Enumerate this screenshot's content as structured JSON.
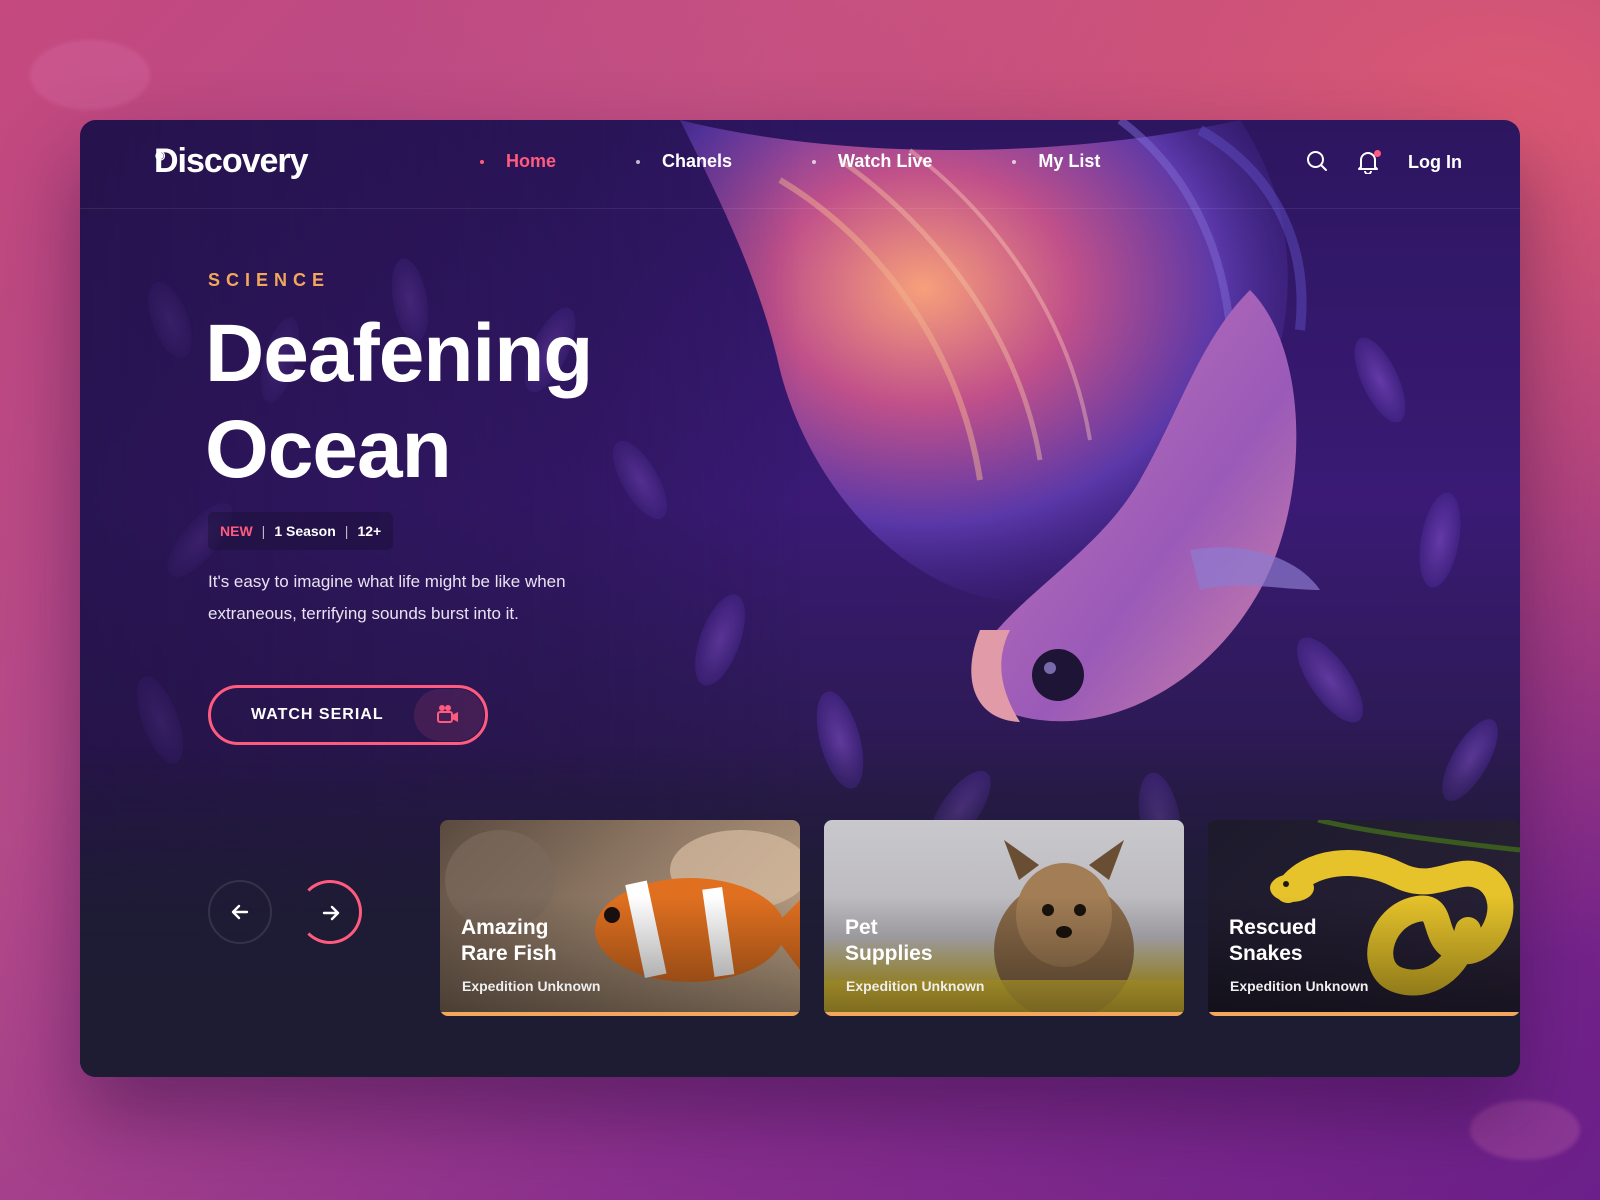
{
  "brand": {
    "name": "Discovery",
    "accent": "#ff5b7f",
    "secondary": "#f2a75c"
  },
  "nav": {
    "items": [
      {
        "label": "Home",
        "active": true
      },
      {
        "label": "Chanels",
        "active": false
      },
      {
        "label": "Watch Live",
        "active": false
      },
      {
        "label": "My List",
        "active": false
      }
    ],
    "search_icon": "search-icon",
    "bell_icon": "bell-icon",
    "login_label": "Log In"
  },
  "hero": {
    "category": "SCIENCE",
    "title_line1": "Deafening",
    "title_line2": "Ocean",
    "meta": {
      "badge": "NEW",
      "seasons": "1 Season",
      "rating": "12+"
    },
    "description": "It's easy to imagine what life might be like when extraneous, terrifying sounds burst into it.",
    "cta_label": "WATCH SERIAL",
    "cta_icon": "video-camera-icon"
  },
  "carousel": {
    "prev_icon": "arrow-left-icon",
    "next_icon": "arrow-right-icon",
    "cards": [
      {
        "title_line1": "Amazing",
        "title_line2": "Rare Fish",
        "subtitle": "Expedition Unknown"
      },
      {
        "title_line1": "Pet",
        "title_line2": "Supplies",
        "subtitle": "Expedition Unknown"
      },
      {
        "title_line1": "Rescued",
        "title_line2": "Snakes",
        "subtitle": "Expedition Unknown"
      }
    ]
  }
}
